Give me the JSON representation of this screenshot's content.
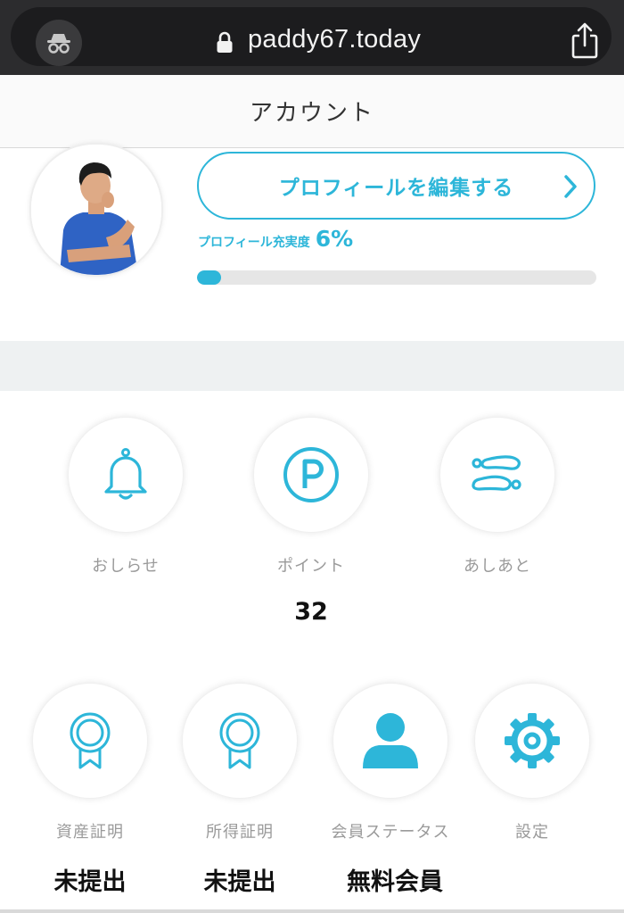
{
  "browser": {
    "url": "paddy67.today"
  },
  "header": {
    "title": "アカウント"
  },
  "profile": {
    "edit_label": "プロフィールを編集する",
    "completion_label": "プロフィール充実度",
    "completion_value": "6%",
    "completion_fraction": 0.06
  },
  "menu_top": [
    {
      "label": "おしらせ",
      "icon": "bell-icon"
    },
    {
      "label": "ポイント",
      "icon": "point-icon",
      "value": "32"
    },
    {
      "label": "あしあと",
      "icon": "footprints-icon"
    }
  ],
  "menu_bottom": [
    {
      "label": "資産証明",
      "icon": "ribbon-icon",
      "value": "未提出"
    },
    {
      "label": "所得証明",
      "icon": "ribbon-icon",
      "value": "未提出"
    },
    {
      "label": "会員ステータス",
      "icon": "person-icon",
      "value": "無料会員"
    },
    {
      "label": "設定",
      "icon": "gear-icon"
    }
  ],
  "colors": {
    "accent": "#2db6d9",
    "chrome": "#2c2c2e",
    "band": "#eef1f2"
  }
}
